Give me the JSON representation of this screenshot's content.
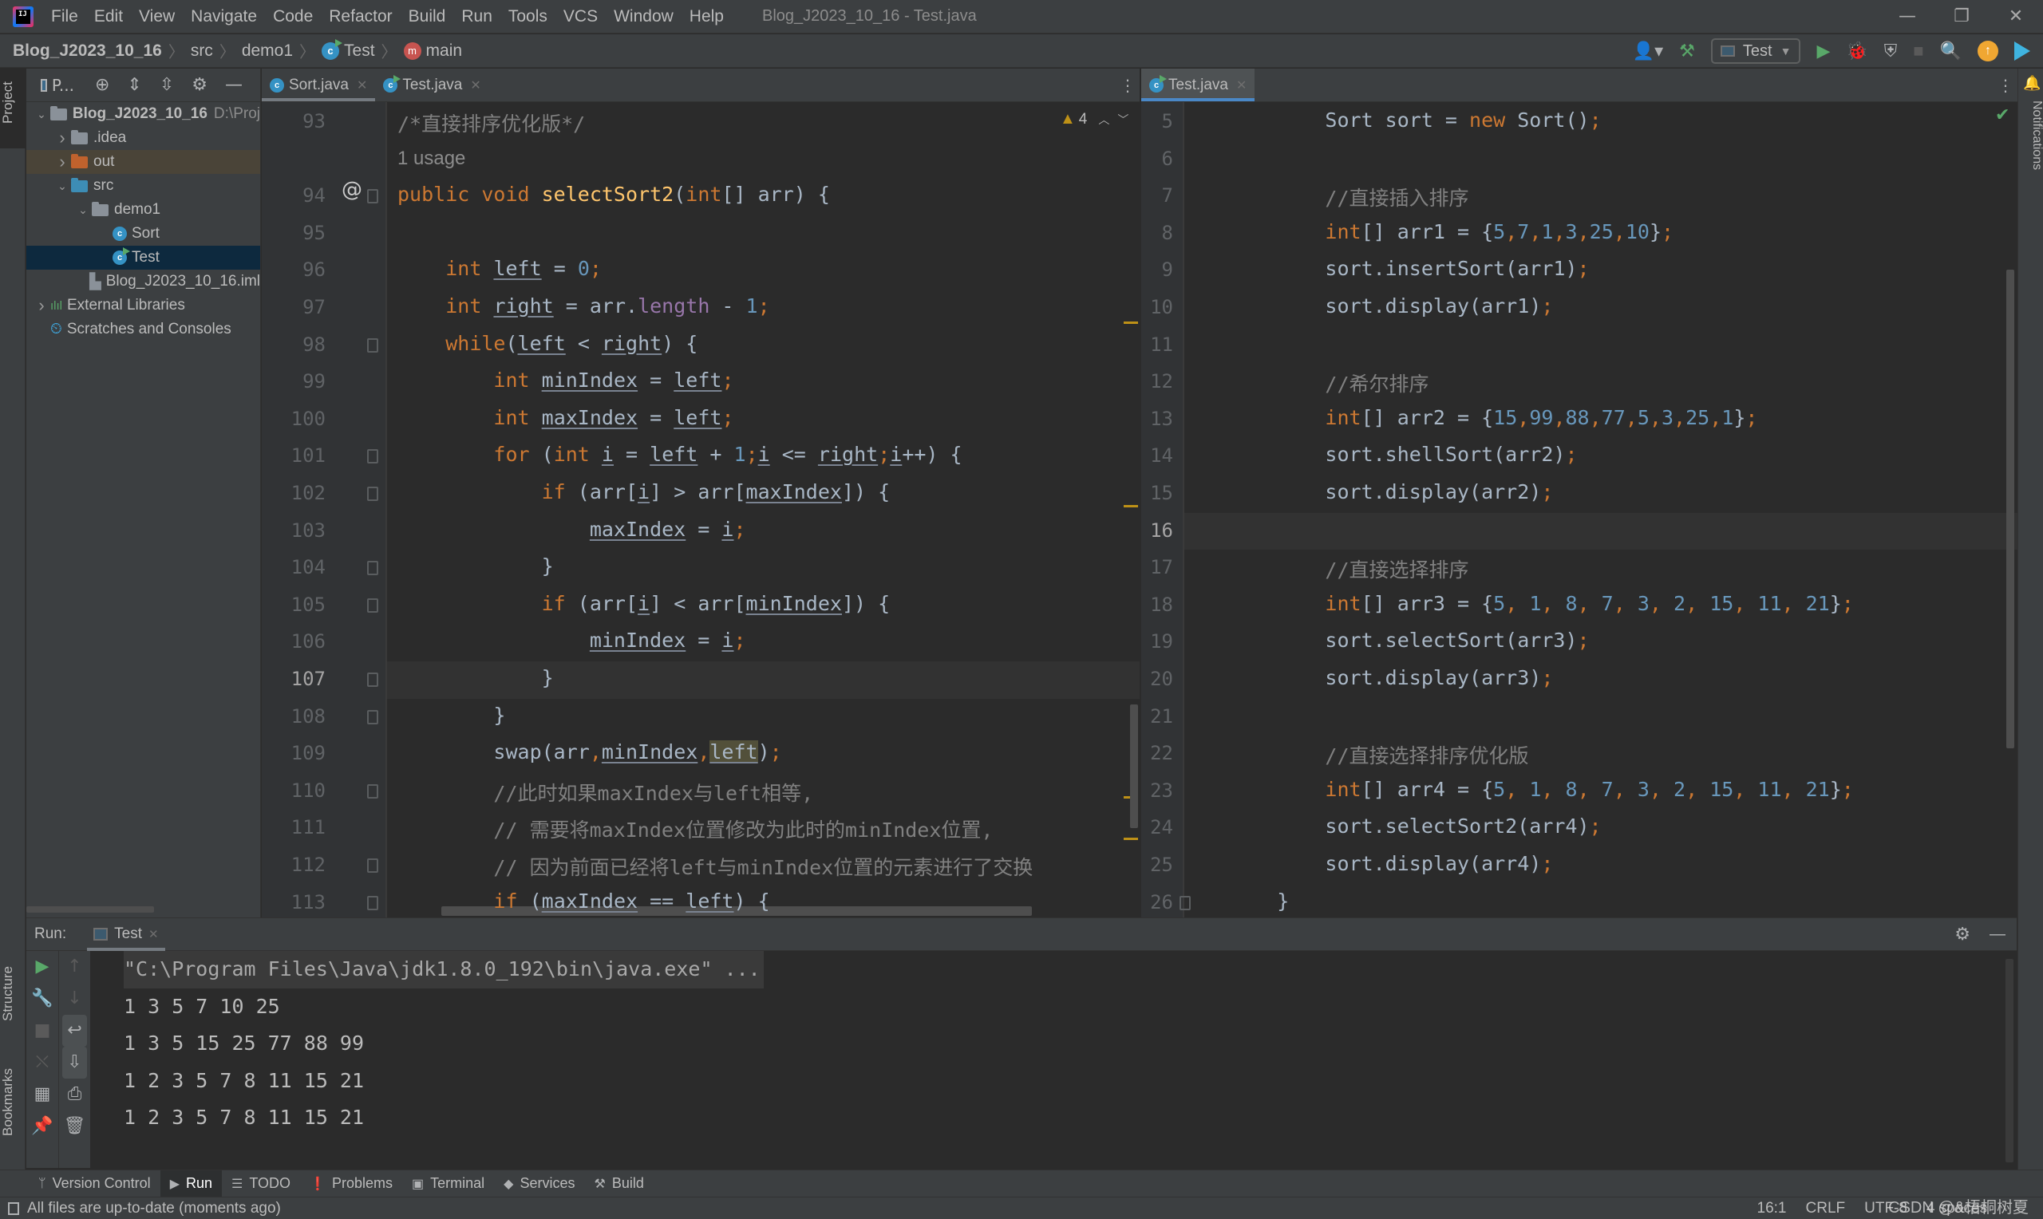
{
  "window": {
    "title": "Blog_J2023_10_16 - Test.java",
    "menu": [
      "File",
      "Edit",
      "View",
      "Navigate",
      "Code",
      "Refactor",
      "Build",
      "Run",
      "Tools",
      "VCS",
      "Window",
      "Help"
    ],
    "controls": {
      "minimize": "—",
      "restore": "❐",
      "close": "✕"
    }
  },
  "breadcrumb": {
    "project": "Blog_J2023_10_16",
    "items": [
      "src",
      "demo1",
      "Test",
      "main"
    ]
  },
  "toolbar": {
    "run_config": "Test"
  },
  "left_stripe": {
    "project_tab": "Project",
    "structure_tab": "Structure",
    "bookmarks_tab": "Bookmarks"
  },
  "right_stripe": {
    "notifications_tab": "Notifications"
  },
  "project_panel": {
    "title": "P...",
    "tree": [
      {
        "label": "Blog_J2023_10_16",
        "path": "D:\\Proj",
        "depth": 0,
        "expanded": true,
        "kind": "module"
      },
      {
        "label": ".idea",
        "depth": 1,
        "expanded": false,
        "kind": "folder"
      },
      {
        "label": "out",
        "depth": 1,
        "expanded": false,
        "kind": "folder-excluded"
      },
      {
        "label": "src",
        "depth": 1,
        "expanded": true,
        "kind": "folder-source"
      },
      {
        "label": "demo1",
        "depth": 2,
        "expanded": true,
        "kind": "package"
      },
      {
        "label": "Sort",
        "depth": 3,
        "kind": "class"
      },
      {
        "label": "Test",
        "depth": 3,
        "kind": "class-main",
        "selected": true
      },
      {
        "label": "Blog_J2023_10_16.iml",
        "depth": 2,
        "kind": "iml"
      },
      {
        "label": "External Libraries",
        "depth": 0,
        "expanded": false,
        "kind": "libraries"
      },
      {
        "label": "Scratches and Consoles",
        "depth": 0,
        "kind": "scratches"
      }
    ]
  },
  "left_editor": {
    "tabs": [
      {
        "label": "Sort.java",
        "active": true
      },
      {
        "label": "Test.java",
        "active": false
      }
    ],
    "warnings": "4",
    "usage_hint": "1 usage",
    "current_line": "107",
    "lines": [
      {
        "n": "93",
        "html": "<span class='c'>/*直接排序优化版*/</span>"
      },
      {
        "n": "",
        "html": "<span class='inlay'>1 usage</span>"
      },
      {
        "n": "94",
        "html": "<span class='k'>public void </span><span class='f'>selectSort2</span>(<span class='k'>int</span>[] arr) {"
      },
      {
        "n": "95",
        "html": ""
      },
      {
        "n": "96",
        "html": "    <span class='k'>int </span><span class='u'>left</span> = <span class='n'>0</span><span class='semi'>;</span>"
      },
      {
        "n": "97",
        "html": "    <span class='k'>int </span><span class='u'>right</span> = arr.<span class='p'>length</span> - <span class='n'>1</span><span class='semi'>;</span>"
      },
      {
        "n": "98",
        "html": "    <span class='k'>while</span>(<span class='u'>left</span> &lt; <span class='u'>right</span>) {"
      },
      {
        "n": "99",
        "html": "        <span class='k'>int </span><span class='u'>minIndex</span> = <span class='u'>left</span><span class='semi'>;</span>"
      },
      {
        "n": "100",
        "html": "        <span class='k'>int </span><span class='u'>maxIndex</span> = <span class='u'>left</span><span class='semi'>;</span>"
      },
      {
        "n": "101",
        "html": "        <span class='k'>for </span>(<span class='k'>int </span><span class='u'>i</span> = <span class='u'>left</span> + <span class='n'>1</span><span class='semi'>;</span><span class='u'>i</span> &lt;= <span class='u'>right</span><span class='semi'>;</span><span class='u'>i</span>++) {"
      },
      {
        "n": "102",
        "html": "            <span class='k'>if </span>(arr[<span class='u'>i</span>] &gt; arr[<span class='u'>maxIndex</span>]) {"
      },
      {
        "n": "103",
        "html": "                <span class='u'>maxIndex</span> = <span class='u'>i</span><span class='semi'>;</span>"
      },
      {
        "n": "104",
        "html": "            }"
      },
      {
        "n": "105",
        "html": "            <span class='k'>if </span>(arr[<span class='u'>i</span>] &lt; arr[<span class='u'>minIndex</span>]) {"
      },
      {
        "n": "106",
        "html": "                <span class='u'>minIndex</span> = <span class='u'>i</span><span class='semi'>;</span>"
      },
      {
        "n": "107",
        "html": "            }"
      },
      {
        "n": "108",
        "html": "        }"
      },
      {
        "n": "109",
        "html": "        swap(arr<span class='semi'>,</span><span class='u'>minIndex</span><span class='semi'>,</span><span class='u hl'>left</span>)<span class='semi'>;</span>"
      },
      {
        "n": "110",
        "html": "        <span class='c'>//此时如果maxIndex与left相等,</span>"
      },
      {
        "n": "111",
        "html": "        <span class='c'>// 需要将maxIndex位置修改为此时的minIndex位置,</span>"
      },
      {
        "n": "112",
        "html": "        <span class='c'>// 因为前面已经将left与minIndex位置的元素进行了交换</span>"
      },
      {
        "n": "113",
        "html": "        <span class='k'>if </span>(<span class='u'>maxIndex</span> == <span class='u'>left</span>) {"
      }
    ]
  },
  "right_editor": {
    "tabs": [
      {
        "label": "Test.java",
        "active": true
      }
    ],
    "current_line": "16",
    "lines": [
      {
        "n": "5",
        "html": "        Sort sort = <span class='k'>new </span>Sort()<span class='semi'>;</span>"
      },
      {
        "n": "6",
        "html": ""
      },
      {
        "n": "7",
        "html": "        <span class='c'>//直接插入排序</span>"
      },
      {
        "n": "8",
        "html": "        <span class='k'>int</span>[] arr1 = {<span class='n'>5</span><span class='semi'>,</span><span class='n'>7</span><span class='semi'>,</span><span class='n'>1</span><span class='semi'>,</span><span class='n'>3</span><span class='semi'>,</span><span class='n'>25</span><span class='semi'>,</span><span class='n'>10</span>}<span class='semi'>;</span>"
      },
      {
        "n": "9",
        "html": "        sort.insertSort(arr1)<span class='semi'>;</span>"
      },
      {
        "n": "10",
        "html": "        sort.display(arr1)<span class='semi'>;</span>"
      },
      {
        "n": "11",
        "html": ""
      },
      {
        "n": "12",
        "html": "        <span class='c'>//希尔排序</span>"
      },
      {
        "n": "13",
        "html": "        <span class='k'>int</span>[] arr2 = {<span class='n'>15</span><span class='semi'>,</span><span class='n'>99</span><span class='semi'>,</span><span class='n'>88</span><span class='semi'>,</span><span class='n'>77</span><span class='semi'>,</span><span class='n'>5</span><span class='semi'>,</span><span class='n'>3</span><span class='semi'>,</span><span class='n'>25</span><span class='semi'>,</span><span class='n'>1</span>}<span class='semi'>;</span>"
      },
      {
        "n": "14",
        "html": "        sort.shellSort(arr2)<span class='semi'>;</span>"
      },
      {
        "n": "15",
        "html": "        sort.display(arr2)<span class='semi'>;</span>"
      },
      {
        "n": "16",
        "html": ""
      },
      {
        "n": "17",
        "html": "        <span class='c'>//直接选择排序</span>"
      },
      {
        "n": "18",
        "html": "        <span class='k'>int</span>[] arr3 = {<span class='n'>5</span><span class='semi'>, </span><span class='n'>1</span><span class='semi'>, </span><span class='n'>8</span><span class='semi'>, </span><span class='n'>7</span><span class='semi'>, </span><span class='n'>3</span><span class='semi'>, </span><span class='n'>2</span><span class='semi'>, </span><span class='n'>15</span><span class='semi'>, </span><span class='n'>11</span><span class='semi'>, </span><span class='n'>21</span>}<span class='semi'>;</span>"
      },
      {
        "n": "19",
        "html": "        sort.selectSort(arr3)<span class='semi'>;</span>"
      },
      {
        "n": "20",
        "html": "        sort.display(arr3)<span class='semi'>;</span>"
      },
      {
        "n": "21",
        "html": ""
      },
      {
        "n": "22",
        "html": "        <span class='c'>//直接选择排序优化版</span>"
      },
      {
        "n": "23",
        "html": "        <span class='k'>int</span>[] arr4 = {<span class='n'>5</span><span class='semi'>, </span><span class='n'>1</span><span class='semi'>, </span><span class='n'>8</span><span class='semi'>, </span><span class='n'>7</span><span class='semi'>, </span><span class='n'>3</span><span class='semi'>, </span><span class='n'>2</span><span class='semi'>, </span><span class='n'>15</span><span class='semi'>, </span><span class='n'>11</span><span class='semi'>, </span><span class='n'>21</span>}<span class='semi'>;</span>"
      },
      {
        "n": "24",
        "html": "        sort.selectSort2(arr4)<span class='semi'>;</span>"
      },
      {
        "n": "25",
        "html": "        sort.display(arr4)<span class='semi'>;</span>"
      },
      {
        "n": "26",
        "html": "    }"
      }
    ]
  },
  "run_panel": {
    "label": "Run:",
    "tab": "Test",
    "output": [
      "\"C:\\Program Files\\Java\\jdk1.8.0_192\\bin\\java.exe\" ...",
      "1 3 5 7 10 25",
      "1 3 5 15 25 77 88 99",
      "1 2 3 5 7 8 11 15 21",
      "1 2 3 5 7 8 11 15 21"
    ]
  },
  "tool_windows": [
    {
      "label": "Version Control",
      "icon": "version-control-icon",
      "glyph": "ᛘ"
    },
    {
      "label": "Run",
      "icon": "run-icon",
      "glyph": "▶",
      "active": true
    },
    {
      "label": "TODO",
      "icon": "todo-icon",
      "glyph": "☰"
    },
    {
      "label": "Problems",
      "icon": "problems-icon",
      "glyph": "❗"
    },
    {
      "label": "Terminal",
      "icon": "terminal-icon",
      "glyph": "▣"
    },
    {
      "label": "Services",
      "icon": "services-icon",
      "glyph": "◆"
    },
    {
      "label": "Build",
      "icon": "build-icon",
      "glyph": "⚒"
    }
  ],
  "status": {
    "message": "All files are up-to-date (moments ago)",
    "position": "16:1",
    "line_sep": "CRLF",
    "encoding": "UTF-8",
    "indent": "4 spaces",
    "watermark": "CSDN @&梧桐树夏"
  },
  "colors": {
    "accent": "#4a88c7",
    "run_green": "#59a869",
    "warning": "#be9117",
    "update_orange": "#f0a732"
  }
}
